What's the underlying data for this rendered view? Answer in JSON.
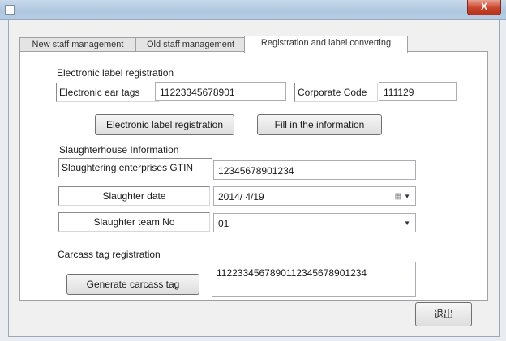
{
  "window": {
    "close_label": "X"
  },
  "tabs": [
    {
      "label": "New staff management",
      "active": false
    },
    {
      "label": "Old staff management",
      "active": false
    },
    {
      "label": "Registration and label converting",
      "active": true
    }
  ],
  "electronic_label": {
    "section_title": "Electronic label registration",
    "ear_tags_label": "Electronic ear tags",
    "ear_tags_value": "11223345678901",
    "corporate_code_label": "Corporate Code",
    "corporate_code_value": "111129",
    "register_button": "Electronic label registration",
    "fill_button": "Fill in the information"
  },
  "slaughterhouse": {
    "section_title": "Slaughterhouse Information",
    "gtin_label": "Slaughtering enterprises GTIN",
    "gtin_value": "12345678901234",
    "date_label": "Slaughter date",
    "date_value": "2014/  4/19",
    "team_label": "Slaughter team No",
    "team_value": "01"
  },
  "carcass": {
    "section_title": "Carcass tag registration",
    "generate_button": "Generate carcass tag",
    "tag_value": "1122334567890112345678901234"
  },
  "exit_button": "退出"
}
